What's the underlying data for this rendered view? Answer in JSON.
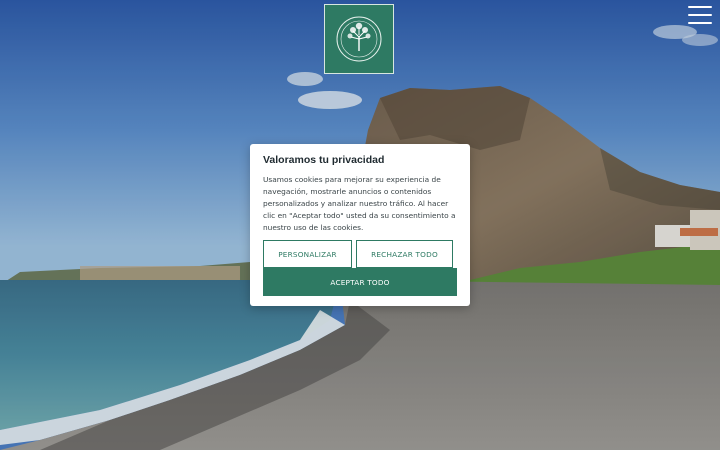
{
  "logo": {
    "icon": "tree-emblem-icon",
    "background": "#2e7a63"
  },
  "menu": {
    "icon": "hamburger-menu-icon"
  },
  "cookie_modal": {
    "title": "Valoramos tu privacidad",
    "body": "Usamos cookies para mejorar su experiencia de navegación, mostrarle anuncios o contenidos personalizados y analizar nuestro tráfico. Al hacer clic en \"Aceptar todo\" usted da su consentimiento a nuestro uso de las cookies.",
    "buttons": {
      "customize": "PERSONALIZAR",
      "reject": "RECHAZAR TODO",
      "accept": "ACEPTAR TODO"
    },
    "accent_color": "#2e7a63"
  }
}
